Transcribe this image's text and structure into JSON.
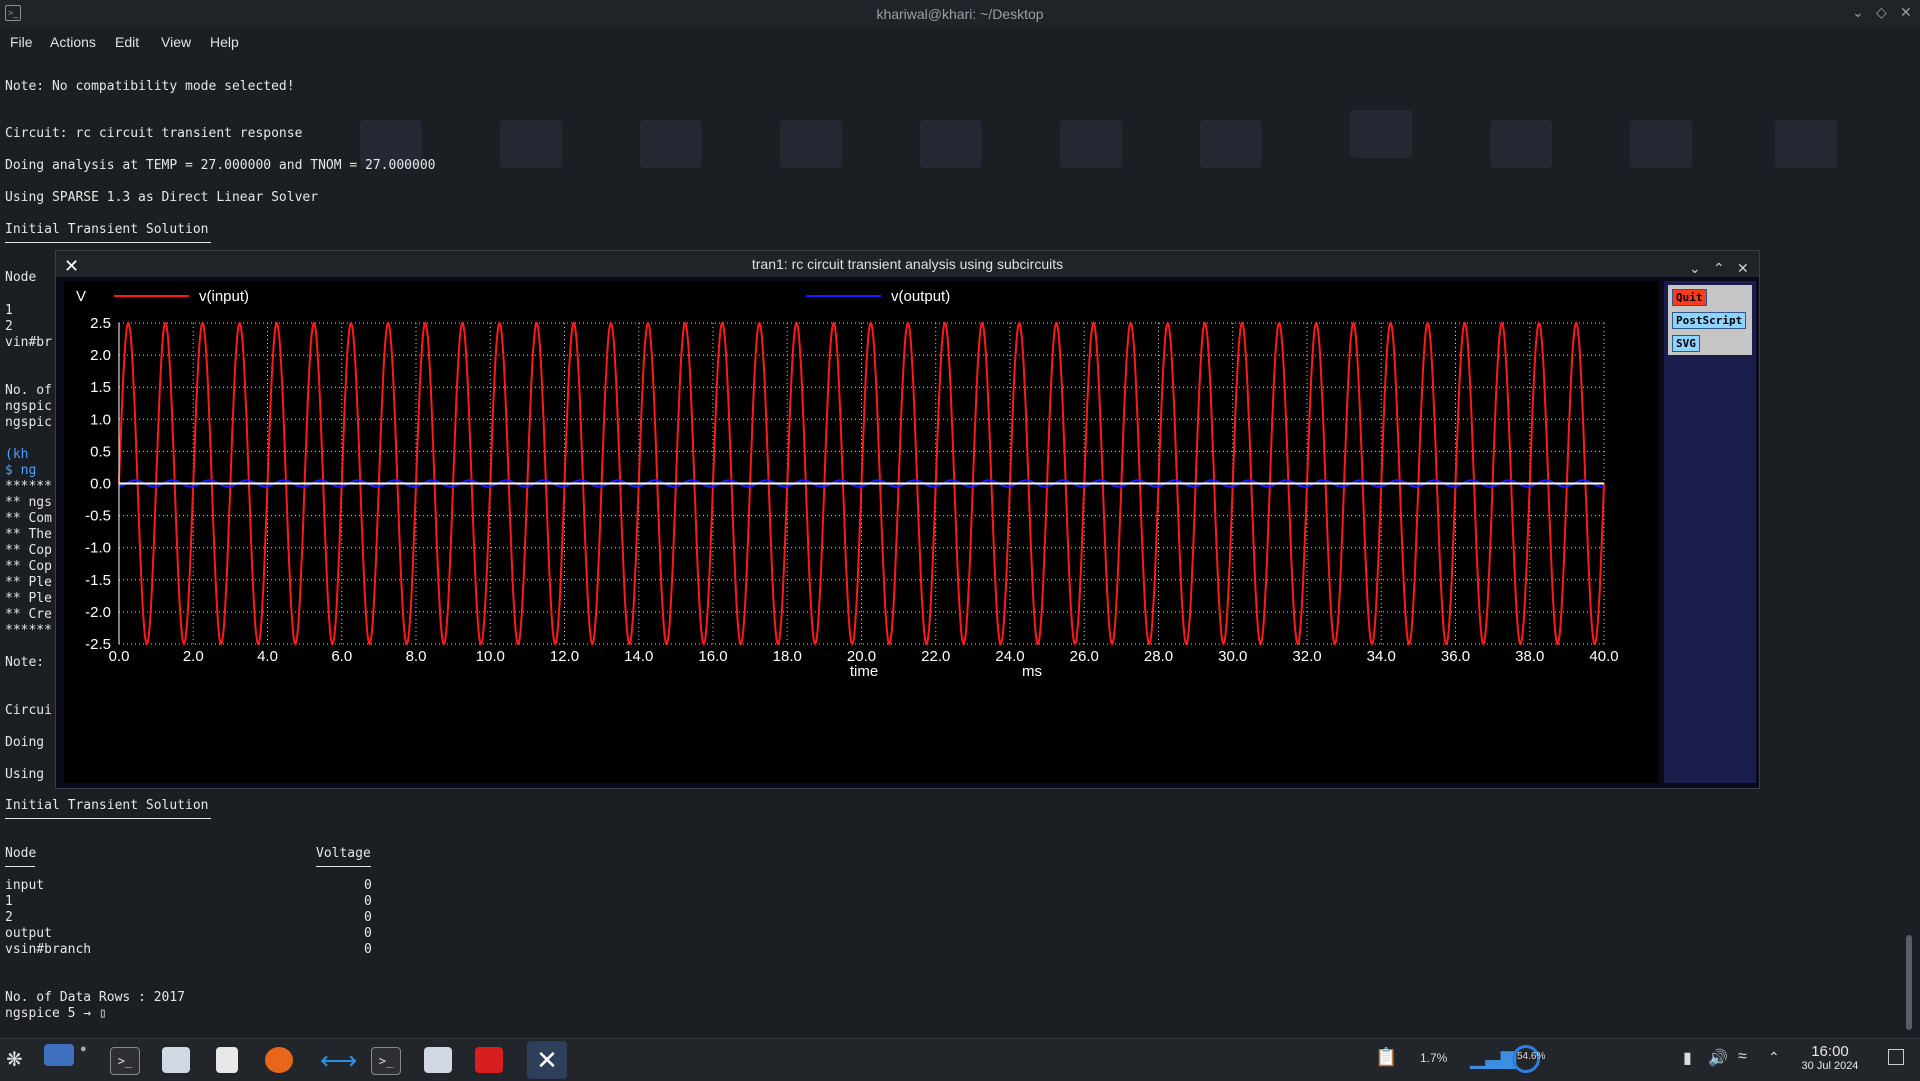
{
  "window": {
    "title": "khariwal@khari: ~/Desktop",
    "menu": [
      "File",
      "Actions",
      "Edit",
      "View",
      "Help"
    ]
  },
  "terminal_top": [
    "Note: No compatibility mode selected!",
    "Circuit: rc circuit transient response",
    "Doing analysis at TEMP = 27.000000 and TNOM = 27.000000",
    "Using SPARSE 1.3 as Direct Linear Solver",
    "Initial Transient Solution"
  ],
  "terminal_left_fragments": [
    "Node",
    "1",
    "2",
    "vin#br",
    "No. of",
    "ngspic",
    "ngspic",
    "(kh",
    "$ ng",
    "******",
    "** ngs",
    "** Com",
    "** The",
    "** Cop",
    "** Cop",
    "** Ple",
    "** Ple",
    "** Cre",
    "******",
    "Note:",
    "Circui",
    "Doing",
    "Using"
  ],
  "terminal_bottom": {
    "heading": "Initial Transient Solution",
    "col_node": "Node",
    "col_voltage": "Voltage",
    "rows": [
      {
        "node": "input",
        "voltage": "0"
      },
      {
        "node": "1",
        "voltage": "0"
      },
      {
        "node": "2",
        "voltage": "0"
      },
      {
        "node": "output",
        "voltage": "0"
      },
      {
        "node": "vsin#branch",
        "voltage": "0"
      }
    ],
    "data_rows": "No. of Data Rows : 2017",
    "prompt": "ngspice 5 → "
  },
  "plot_window": {
    "title": "tran1: rc circuit transient analysis using subcircuits",
    "buttons": [
      "Quit",
      "PostScript",
      "SVG"
    ],
    "button_colors": [
      "#ff3b1f",
      "#8fd3ff",
      "#8fd3ff"
    ]
  },
  "chart_data": {
    "type": "line",
    "ylabel": "V",
    "xlabel": "time",
    "xunit": "ms",
    "xlim": [
      0,
      40
    ],
    "ylim": [
      -2.5,
      2.5
    ],
    "x_ticks": [
      "0.0",
      "2.0",
      "4.0",
      "6.0",
      "8.0",
      "10.0",
      "12.0",
      "14.0",
      "16.0",
      "18.0",
      "20.0",
      "22.0",
      "24.0",
      "26.0",
      "28.0",
      "30.0",
      "32.0",
      "34.0",
      "36.0",
      "38.0",
      "40.0"
    ],
    "y_ticks": [
      "2.5",
      "2.0",
      "1.5",
      "1.0",
      "0.5",
      "0.0",
      "-0.5",
      "-1.0",
      "-1.5",
      "-2.0",
      "-2.5"
    ],
    "grid": true,
    "series": [
      {
        "name": "v(input)",
        "color": "#ff1a1a",
        "kind": "sine",
        "amplitude": 2.5,
        "frequency_hz": 1000
      },
      {
        "name": "v(output)",
        "color": "#1a1aff",
        "kind": "sine",
        "amplitude": 0.05,
        "frequency_hz": 1000
      }
    ]
  },
  "taskbar": {
    "cpu": "1.7%",
    "mem": "54.6%",
    "time": "16:00",
    "date": "30 Jul 2024"
  }
}
